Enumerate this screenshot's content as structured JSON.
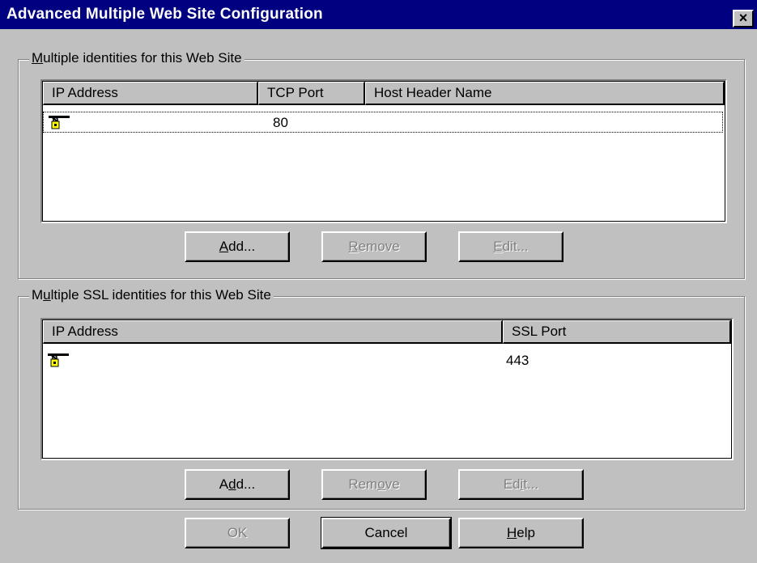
{
  "window": {
    "title": "Advanced Multiple Web Site Configuration",
    "close_label": "×"
  },
  "identities": {
    "group_label_pre": "",
    "group_label_mn": "M",
    "group_label_post": "ultiple identities for this Web Site",
    "columns": [
      "IP Address",
      "TCP Port",
      "Host Header Name"
    ],
    "rows": [
      {
        "icon": "network-lock-icon",
        "ip": "",
        "port": "80",
        "host": ""
      }
    ],
    "buttons": {
      "add": {
        "pre": "",
        "mn": "A",
        "post": "dd..."
      },
      "remove": {
        "pre": "",
        "mn": "R",
        "post": "emove"
      },
      "edit": {
        "pre": "",
        "mn": "E",
        "post": "dit..."
      }
    }
  },
  "ssl": {
    "group_label_pre": "M",
    "group_label_mn": "u",
    "group_label_post": "ltiple SSL identities for this Web Site",
    "columns": [
      "IP Address",
      "SSL Port"
    ],
    "rows": [
      {
        "icon": "network-lock-icon",
        "ip": "",
        "port": "443"
      }
    ],
    "buttons": {
      "add": {
        "pre": "A",
        "mn": "d",
        "post": "d..."
      },
      "remove": {
        "pre": "Rem",
        "mn": "o",
        "post": "ve"
      },
      "edit": {
        "pre": "Ed",
        "mn": "i",
        "post": "t..."
      }
    }
  },
  "footer": {
    "ok": "OK",
    "cancel": "Cancel",
    "help": {
      "pre": "",
      "mn": "H",
      "post": "elp"
    }
  }
}
